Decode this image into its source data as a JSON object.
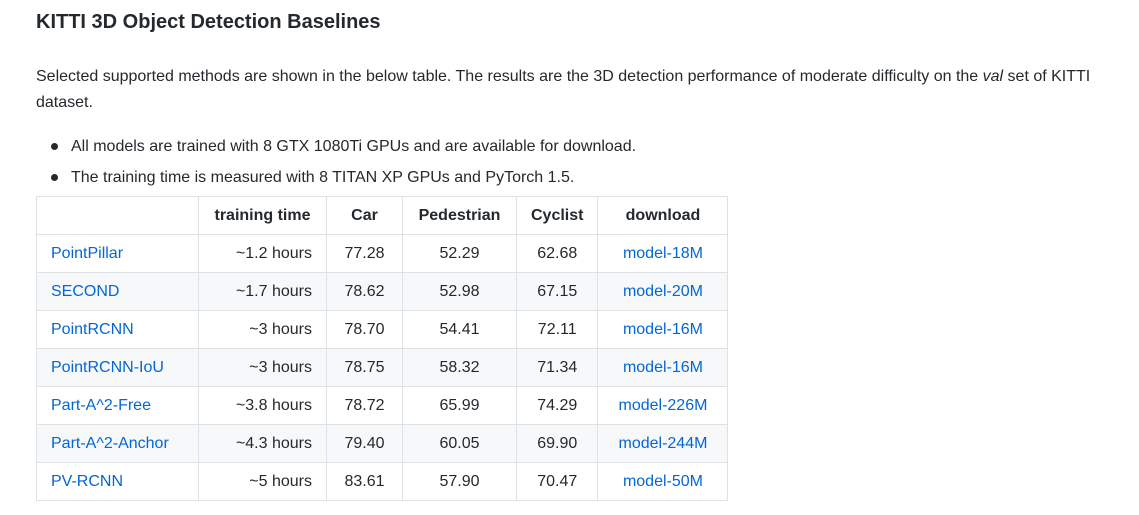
{
  "heading": "KITTI 3D Object Detection Baselines",
  "description": {
    "before_italic": "Selected supported methods are shown in the below table. The results are the 3D detection performance of moderate difficulty on the ",
    "italic": "val",
    "after_italic": " set of KITTI dataset."
  },
  "bullets": [
    "All models are trained with 8 GTX 1080Ti GPUs and are available for download.",
    "The training time is measured with 8 TITAN XP GPUs and PyTorch 1.5."
  ],
  "table": {
    "headers": [
      "",
      "training time",
      "Car",
      "Pedestrian",
      "Cyclist",
      "download"
    ],
    "rows": [
      {
        "method": "PointPillar",
        "time": "~1.2 hours",
        "car": "77.28",
        "pedestrian": "52.29",
        "cyclist": "62.68",
        "download": "model-18M"
      },
      {
        "method": "SECOND",
        "time": "~1.7 hours",
        "car": "78.62",
        "pedestrian": "52.98",
        "cyclist": "67.15",
        "download": "model-20M"
      },
      {
        "method": "PointRCNN",
        "time": "~3 hours",
        "car": "78.70",
        "pedestrian": "54.41",
        "cyclist": "72.11",
        "download": "model-16M"
      },
      {
        "method": "PointRCNN-IoU",
        "time": "~3 hours",
        "car": "78.75",
        "pedestrian": "58.32",
        "cyclist": "71.34",
        "download": "model-16M"
      },
      {
        "method": "Part-A^2-Free",
        "time": "~3.8 hours",
        "car": "78.72",
        "pedestrian": "65.99",
        "cyclist": "74.29",
        "download": "model-226M"
      },
      {
        "method": "Part-A^2-Anchor",
        "time": "~4.3 hours",
        "car": "79.40",
        "pedestrian": "60.05",
        "cyclist": "69.90",
        "download": "model-244M"
      },
      {
        "method": "PV-RCNN",
        "time": "~5 hours",
        "car": "83.61",
        "pedestrian": "57.90",
        "cyclist": "70.47",
        "download": "model-50M"
      }
    ]
  },
  "colors": {
    "text": "#24292e",
    "link": "#0366d6",
    "border": "#dfe2e5",
    "stripe": "#f6f8fa"
  }
}
